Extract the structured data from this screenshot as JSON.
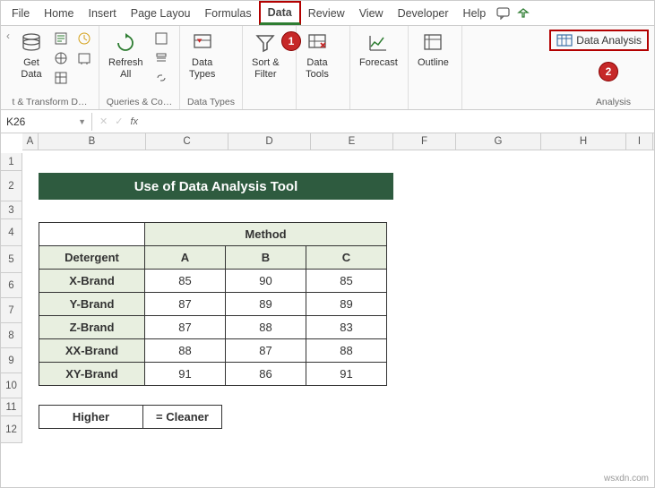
{
  "tabs": [
    "File",
    "Home",
    "Insert",
    "Page Layou",
    "Formulas",
    "Data",
    "Review",
    "View",
    "Developer",
    "Help"
  ],
  "active_tab": "Data",
  "ribbon": {
    "groups": [
      {
        "label": "t & Transform D…",
        "btns": [
          {
            "name": "get-data",
            "label": "Get\nData"
          }
        ]
      },
      {
        "label": "Queries & Co…",
        "btns": [
          {
            "name": "refresh-all",
            "label": "Refresh\nAll"
          }
        ]
      },
      {
        "label": "Data Types",
        "btns": [
          {
            "name": "data-types",
            "label": "Data\nTypes"
          }
        ]
      },
      {
        "label": "",
        "btns": [
          {
            "name": "sort-filter",
            "label": "Sort &\nFilter"
          }
        ]
      },
      {
        "label": "",
        "btns": [
          {
            "name": "data-tools",
            "label": "Data\nTools"
          }
        ]
      },
      {
        "label": "",
        "btns": [
          {
            "name": "forecast",
            "label": "Forecast"
          }
        ]
      },
      {
        "label": "",
        "btns": [
          {
            "name": "outline",
            "label": "Outline"
          }
        ]
      },
      {
        "label": "Analysis",
        "btns": [
          {
            "name": "data-analysis",
            "label": "Data Analysis"
          }
        ]
      }
    ]
  },
  "annotations": {
    "one": "1",
    "two": "2"
  },
  "name_box": "K26",
  "fx_label": "fx",
  "cols": [
    "A",
    "B",
    "C",
    "D",
    "E",
    "F",
    "G",
    "H",
    "I"
  ],
  "rows": [
    "1",
    "2",
    "3",
    "4",
    "5",
    "6",
    "7",
    "8",
    "9",
    "10",
    "11",
    "12"
  ],
  "title": "Use of Data Analysis Tool",
  "table": {
    "method_label": "Method",
    "detergent_label": "Detergent",
    "methods": [
      "A",
      "B",
      "C"
    ],
    "rows": [
      {
        "brand": "X-Brand",
        "vals": [
          85,
          90,
          85
        ]
      },
      {
        "brand": "Y-Brand",
        "vals": [
          87,
          89,
          89
        ]
      },
      {
        "brand": "Z-Brand",
        "vals": [
          87,
          88,
          83
        ]
      },
      {
        "brand": "XX-Brand",
        "vals": [
          88,
          87,
          88
        ]
      },
      {
        "brand": "XY-Brand",
        "vals": [
          91,
          86,
          91
        ]
      }
    ]
  },
  "legend": {
    "left": "Higher",
    "right": "= Cleaner"
  },
  "watermark": "wsxdn.com",
  "chart_data": {
    "type": "table",
    "title": "Use of Data Analysis Tool",
    "columns": [
      "Detergent",
      "A",
      "B",
      "C"
    ],
    "rows": [
      [
        "X-Brand",
        85,
        90,
        85
      ],
      [
        "Y-Brand",
        87,
        89,
        89
      ],
      [
        "Z-Brand",
        87,
        88,
        83
      ],
      [
        "XX-Brand",
        88,
        87,
        88
      ],
      [
        "XY-Brand",
        91,
        86,
        91
      ]
    ],
    "note": "Higher = Cleaner"
  }
}
